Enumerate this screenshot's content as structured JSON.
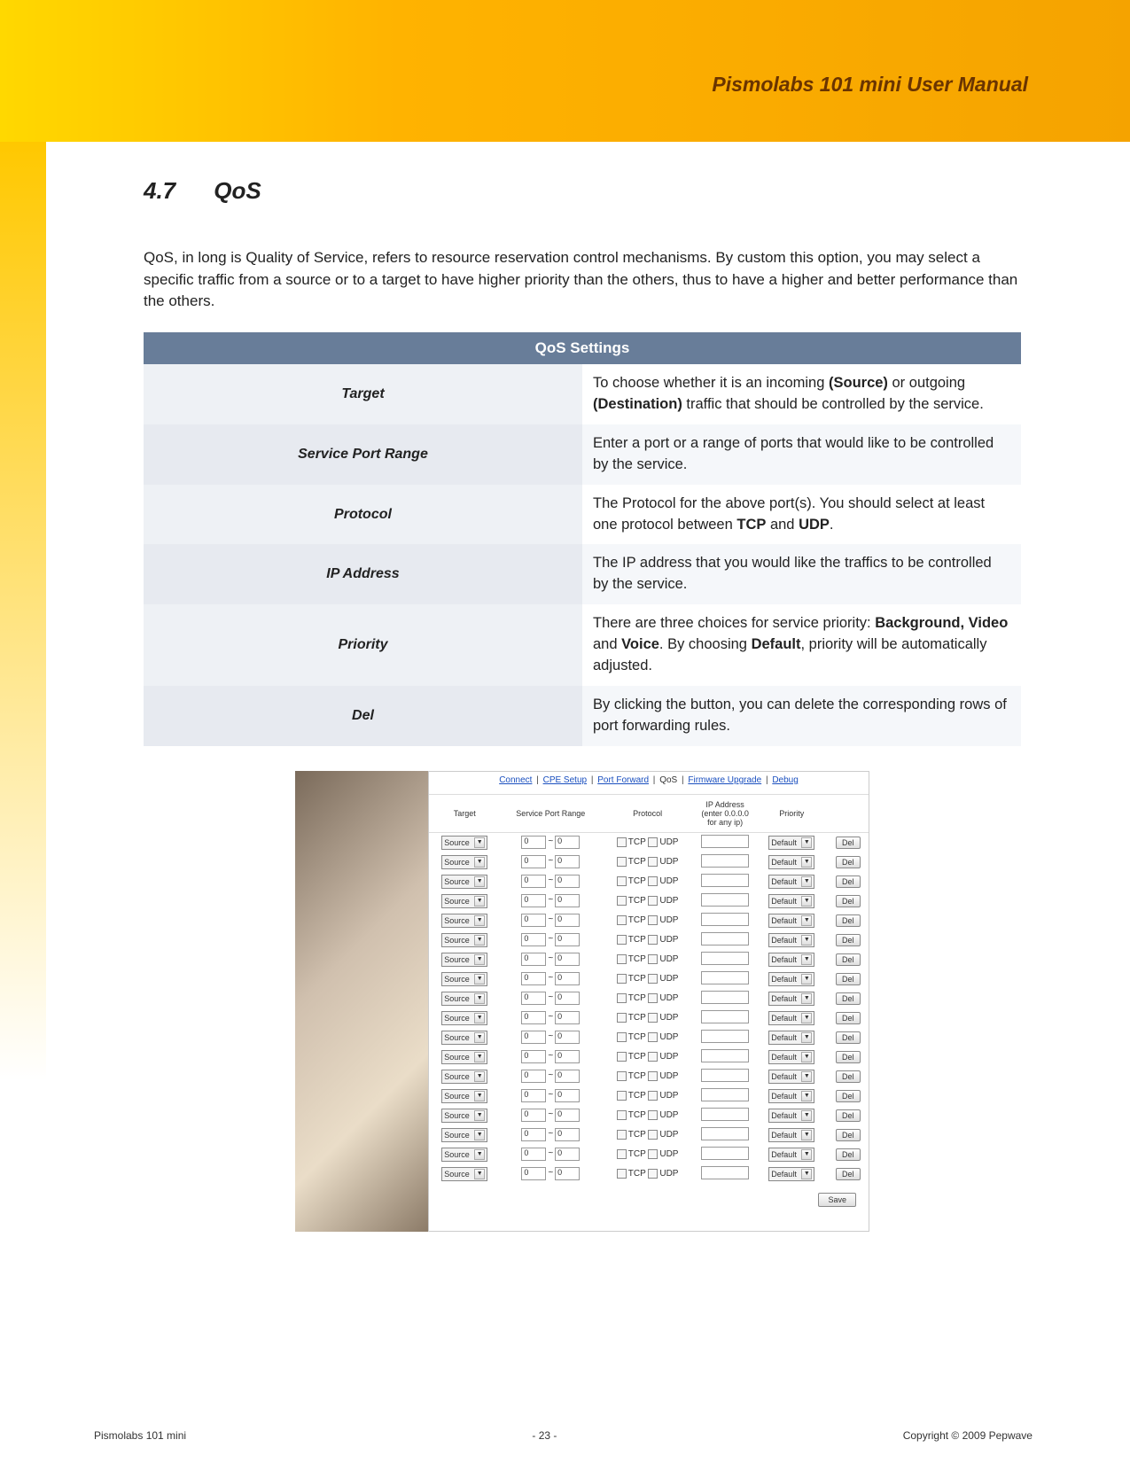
{
  "header": {
    "title": "Pismolabs 101 mini User Manual"
  },
  "section": {
    "number": "4.7",
    "title": "QoS"
  },
  "intro": "QoS, in long is Quality of Service, refers to resource reservation control mechanisms. By custom this option, you may select a specific traffic from a source or to a target to have higher priority than the others, thus to have a higher and better performance than the others.",
  "settings_table": {
    "header": "QoS Settings",
    "rows": [
      {
        "label": "Target",
        "desc_pre": "To choose whether it is an incoming ",
        "b1": "(Source)",
        "mid": " or outgoing ",
        "b2": "(Destination)",
        "desc_post": " traffic that should be controlled by the service."
      },
      {
        "label": "Service Port Range",
        "desc": "Enter a port or a range of ports that would like to be controlled by the service."
      },
      {
        "label": "Protocol",
        "pre": "The Protocol for the above port(s). You should select at least one protocol between ",
        "b1": "TCP",
        "mid": " and ",
        "b2": "UDP",
        "post": "."
      },
      {
        "label": "IP Address",
        "desc": "The IP address that you would like the traffics to be controlled by the service."
      },
      {
        "label": "Priority",
        "pre": "There are three choices for service priority: ",
        "b1": "Background, Video",
        "mid": " and ",
        "b2": "Voice",
        "mid2": ". By choosing ",
        "b3": "Default",
        "post": ", priority will be automatically adjusted."
      },
      {
        "label": "Del",
        "desc": "By clicking the button, you can delete the corresponding rows of port forwarding rules."
      }
    ]
  },
  "screenshot": {
    "nav": {
      "items": [
        "Connect",
        "CPE Setup",
        "Port Forward",
        "QoS",
        "Firmware Upgrade",
        "Debug"
      ],
      "current": "QoS"
    },
    "cols": {
      "target": "Target",
      "spr": "Service Port Range",
      "protocol": "Protocol",
      "ip": "IP Address (enter 0.0.0.0 for any ip)",
      "priority": "Priority"
    },
    "row_defaults": {
      "target": "Source",
      "port_from": "0",
      "port_to": "0",
      "tcp": "TCP",
      "udp": "UDP",
      "ip": "",
      "priority": "Default",
      "del": "Del"
    },
    "row_count": 18,
    "save": "Save",
    "tilde": "~"
  },
  "footer": {
    "left": "Pismolabs 101 mini",
    "center": "- 23 -",
    "right": "Copyright © 2009 Pepwave"
  }
}
